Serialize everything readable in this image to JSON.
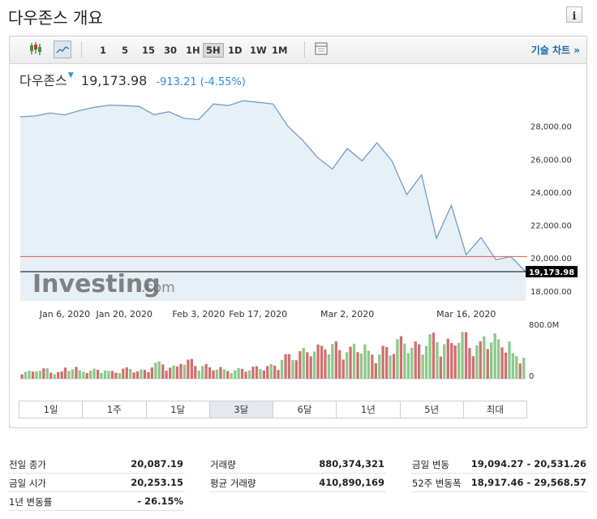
{
  "header": {
    "title": "다우존스 개요",
    "info_button": "i"
  },
  "toolbar": {
    "icons": [
      "candlestick-icon",
      "line-chart-icon",
      "panel-icon"
    ],
    "timeframes": [
      "1",
      "5",
      "15",
      "30",
      "1H",
      "5H",
      "1D",
      "1W",
      "1M"
    ],
    "active_timeframe": "5H",
    "technical_link": "기술 차트 »"
  },
  "quote": {
    "name": "다우존스",
    "arrow": "▼",
    "price": "19,173.98",
    "change": "-913.21 (-4.55%)"
  },
  "watermark": {
    "brand": "Investing",
    "suffix": ".com"
  },
  "chart_data": {
    "type": "area",
    "x": [
      "Dec 26 2019",
      "Dec 30 2019",
      "Jan 2 2020",
      "Jan 6 2020",
      "Jan 9 2020",
      "Jan 13 2020",
      "Jan 16 2020",
      "Jan 20 2020",
      "Jan 23 2020",
      "Jan 27 2020",
      "Jan 28 2020",
      "Jan 31 2020",
      "Feb 3 2020",
      "Feb 6 2020",
      "Feb 10 2020",
      "Feb 13 2020",
      "Feb 17 2020",
      "Feb 20 2020",
      "Feb 24 2020",
      "Feb 25 2020",
      "Feb 27 2020",
      "Feb 28 2020",
      "Mar 2 2020",
      "Mar 3 2020",
      "Mar 5 2020",
      "Mar 6 2020",
      "Mar 9 2020",
      "Mar 10 2020",
      "Mar 12 2020",
      "Mar 13 2020",
      "Mar 16 2020",
      "Mar 17 2020",
      "Mar 18 2020",
      "Mar 19 2020",
      "Mar 20 2020"
    ],
    "close": [
      28580,
      28620,
      28800,
      28690,
      28950,
      29150,
      29280,
      29250,
      29200,
      28700,
      28880,
      28480,
      28400,
      29350,
      29250,
      29550,
      29450,
      29350,
      28000,
      27150,
      26100,
      25400,
      26650,
      25900,
      27000,
      25900,
      23850,
      25050,
      21200,
      23200,
      20200,
      21250,
      19900,
      20087,
      19173.98
    ],
    "volume_m": [
      120,
      160,
      110,
      180,
      130,
      150,
      120,
      170,
      140,
      260,
      200,
      300,
      220,
      180,
      140,
      160,
      190,
      220,
      380,
      460,
      520,
      560,
      480,
      540,
      420,
      500,
      640,
      560,
      700,
      600,
      720,
      560,
      690,
      600,
      380
    ],
    "reference_lines": [
      {
        "name": "previous close",
        "value": 20087.19,
        "color": "#e05a5a"
      },
      {
        "name": "last price",
        "value": 19173.98,
        "color": "#000000",
        "label": "19,173.98"
      }
    ],
    "y_ticks": [
      "18,000.00",
      "20,000.00",
      "22,000.00",
      "24,000.00",
      "26,000.00",
      "28,000.00"
    ],
    "y_tick_values": [
      18000,
      20000,
      22000,
      24000,
      26000,
      28000
    ],
    "x_ticks": [
      "Jan 6, 2020",
      "Jan 20, 2020",
      "Feb 3, 2020",
      "Feb 17, 2020",
      "Mar 2, 2020",
      "Mar 16, 2020"
    ],
    "volume_ticks": [
      "800.0M",
      "0"
    ],
    "ylim": [
      17400,
      30000
    ],
    "volume_max_m": 800,
    "colors": {
      "line": "#6f9ccc",
      "fill": "#e7eff7",
      "vol_up": "#8cc98a",
      "vol_down": "#d07070"
    }
  },
  "range_tabs": [
    "1일",
    "1주",
    "1달",
    "3달",
    "6달",
    "1년",
    "5년",
    "최대"
  ],
  "active_range": "3달",
  "stats": {
    "col1": [
      {
        "label": "전일 종가",
        "value": "20,087.19"
      },
      {
        "label": "금일 시가",
        "value": "20,253.15"
      },
      {
        "label": "1년 변동률",
        "value": "- 26.15%"
      }
    ],
    "col2": [
      {
        "label": "거래량",
        "value": "880,374,321"
      },
      {
        "label": "평균 거래량",
        "value": "410,890,169"
      }
    ],
    "col3": [
      {
        "label": "금일 변동",
        "value": "19,094.27 - 20,531.26"
      },
      {
        "label": "52주 변동폭",
        "value": "18,917.46 - 29,568.57"
      }
    ]
  }
}
